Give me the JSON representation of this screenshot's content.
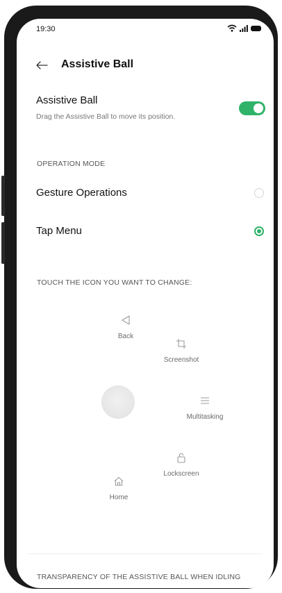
{
  "status_bar": {
    "time": "19:30",
    "icons": [
      "wifi-icon",
      "signal-icon",
      "battery-icon"
    ]
  },
  "header": {
    "back_icon": "arrow-left-icon",
    "title": "Assistive Ball"
  },
  "assistive_ball_setting": {
    "title": "Assistive Ball",
    "description": "Drag the Assistive Ball to move its position.",
    "enabled": true
  },
  "operation_mode": {
    "section_label": "OPERATION MODE",
    "options": [
      {
        "label": "Gesture Operations",
        "selected": false
      },
      {
        "label": "Tap Menu",
        "selected": true
      }
    ]
  },
  "icon_editor": {
    "section_label": "TOUCH THE ICON YOU WANT TO CHANGE:",
    "items": [
      {
        "label": "Back",
        "icon": "back-triangle-icon"
      },
      {
        "label": "Screenshot",
        "icon": "screenshot-icon"
      },
      {
        "label": "Multitasking",
        "icon": "menu-lines-icon"
      },
      {
        "label": "Lockscreen",
        "icon": "lock-icon"
      },
      {
        "label": "Home",
        "icon": "home-icon"
      }
    ]
  },
  "transparency": {
    "section_label": "TRANSPARENCY OF THE ASSISTIVE BALL WHEN IDLING"
  },
  "colors": {
    "accent": "#2fb369",
    "text_primary": "#111111",
    "text_secondary": "#777777",
    "frame": "#1a1a1a"
  }
}
